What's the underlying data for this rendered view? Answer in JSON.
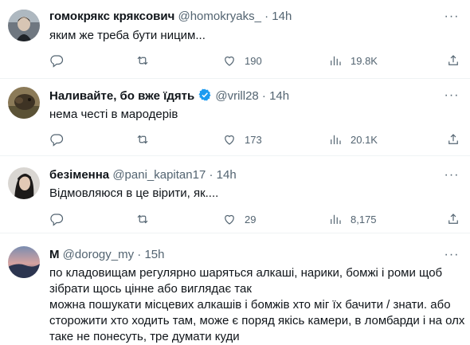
{
  "tweets": [
    {
      "name": "гомокрякс кряксович",
      "handle": "@homokryaks_",
      "time": "14h",
      "text": "яким же треба бути ницим...",
      "replies": "",
      "retweets": "",
      "likes": "190",
      "views": "19.8K"
    },
    {
      "name": "Наливайте, бо вже їдять",
      "handle": "@vrill28",
      "time": "14h",
      "text": "нема честі в мародерів",
      "replies": "",
      "retweets": "",
      "likes": "173",
      "views": "20.1K"
    },
    {
      "name": "безіменна",
      "handle": "@pani_kapitan17",
      "time": "14h",
      "text": "Відмовляюся в це вірити, як....",
      "replies": "",
      "retweets": "",
      "likes": "29",
      "views": "8,175"
    },
    {
      "name": "M",
      "handle": "@dorogy_my",
      "time": "15h",
      "text_lines": [
        "по кладовищам регулярно шаряться алкаші, нарики, бомжі і роми щоб",
        "зібрати щось цінне або виглядає так",
        "можна пошукати місцевих алкашів і бомжів хто міг їх бачити / знати. або",
        "сторожити хто ходить там, може є поряд якісь камери, в ломбарди і на олх",
        "таке не понесуть, тре думати куди"
      ]
    }
  ],
  "separator": "·",
  "more_glyph": "···",
  "colors": {
    "verified": "#1d9bf0",
    "secondary": "#536471",
    "divider": "#eff3f4"
  }
}
